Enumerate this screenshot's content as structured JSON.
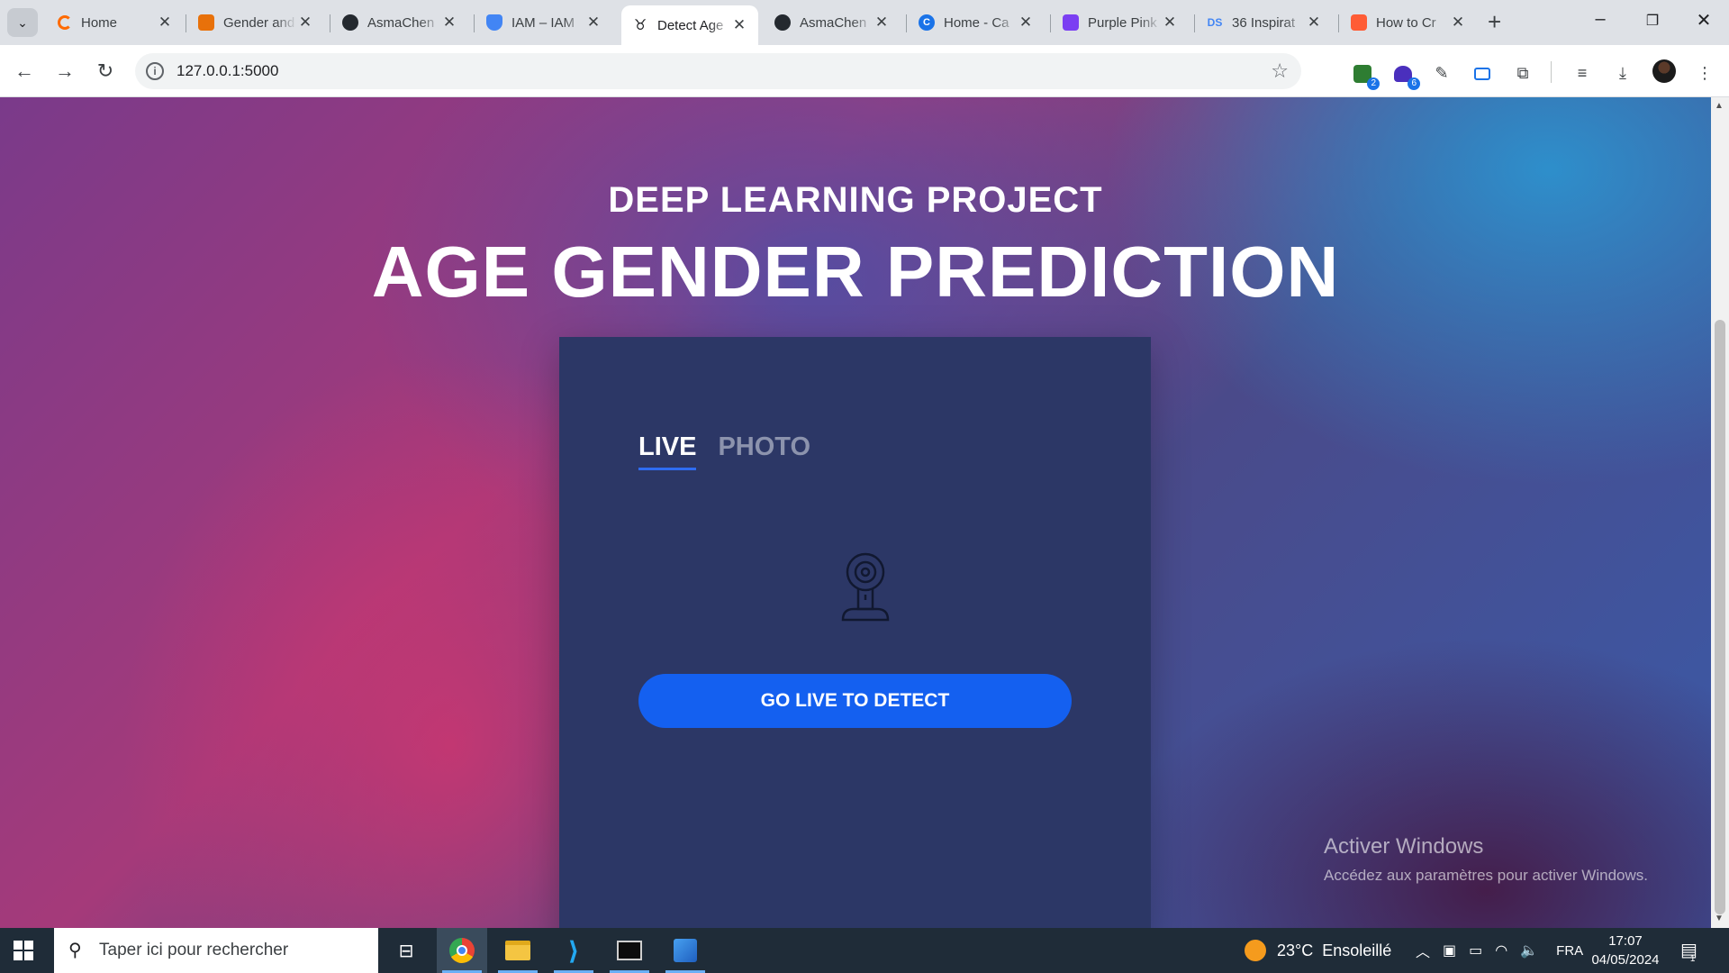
{
  "browser": {
    "tabs": [
      {
        "title": "Home",
        "favicon_color": "#ff6a00"
      },
      {
        "title": "Gender and",
        "favicon_color": "#e8710a"
      },
      {
        "title": "AsmaChen",
        "favicon_color": "#24292f"
      },
      {
        "title": "IAM – IAM",
        "favicon_color": "#4285f4"
      },
      {
        "title": "Detect Age",
        "favicon_color": "#202124"
      },
      {
        "title": "AsmaChen",
        "favicon_color": "#24292f"
      },
      {
        "title": "Home - Ca",
        "favicon_color": "#1a73e8"
      },
      {
        "title": "Purple Pink",
        "favicon_color": "#7b3ff2"
      },
      {
        "title": "36 Inspirat",
        "favicon_color": "#4285f4"
      },
      {
        "title": "How to Cr",
        "favicon_color": "#ff5c35"
      }
    ],
    "active_tab_index": 4,
    "url": "127.0.0.1:5000",
    "extensions": [
      {
        "name": "extension-green-icon",
        "badge": "2"
      },
      {
        "name": "extension-purple-icon",
        "badge": "6"
      },
      {
        "name": "eyedropper-icon",
        "badge": ""
      },
      {
        "name": "screen-capture-icon",
        "badge": ""
      },
      {
        "name": "puzzle-icon",
        "badge": ""
      }
    ]
  },
  "page": {
    "kicker": "DEEP LEARNING PROJECT",
    "headline": "AGE GENDER PREDICTION",
    "card": {
      "tabs": [
        "LIVE",
        "PHOTO"
      ],
      "active_tab": "LIVE",
      "cta_label": "GO LIVE TO DETECT",
      "cta_color": "#1460f0"
    }
  },
  "watermark": {
    "title": "Activer Windows",
    "subtitle": "Accédez aux paramètres pour activer Windows."
  },
  "taskbar": {
    "search_placeholder": "Taper ici pour rechercher",
    "weather": "23°C  Ensoleillé",
    "language": "FRA",
    "time": "17:07",
    "date": "04/05/2024",
    "notification_count": "1"
  }
}
